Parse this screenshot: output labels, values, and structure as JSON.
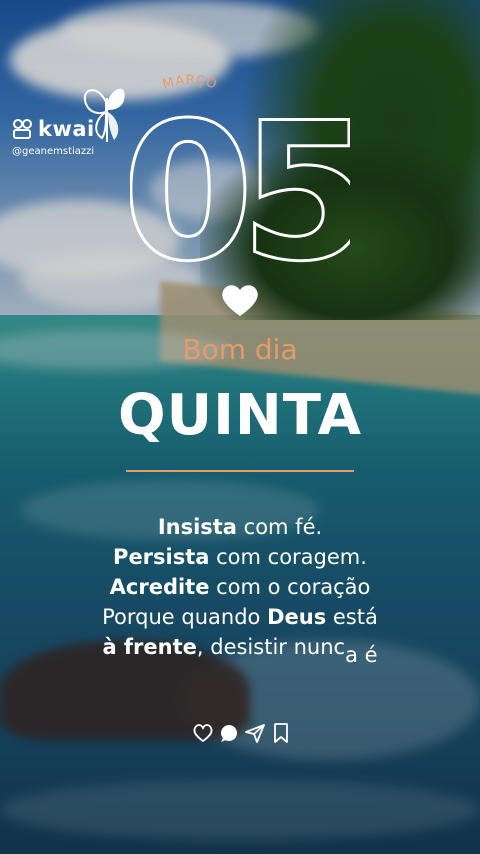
{
  "app": {
    "logo_text": "kwai",
    "handle": "@geanemstiazzi"
  },
  "date": {
    "month": "MARÇO",
    "day": "05"
  },
  "greeting": {
    "line1": "Bom dia",
    "line2": "QUINTA"
  },
  "quote": {
    "l1_bold": "Insista",
    "l1_rest": " com fé.",
    "l2_bold": "Persista",
    "l2_rest": " com coragem.",
    "l3_bold": "Acredite",
    "l3_rest": " com o coração",
    "l4_pre": "Porque quando ",
    "l4_bold": "Deus",
    "l4_post": " está",
    "l5_bold": "à frente",
    "l5_rest": ", desistir nunc",
    "l5_a": "a",
    "l5_e": " é"
  },
  "icons": [
    "heart-icon",
    "comment-icon",
    "send-icon",
    "bookmark-icon"
  ],
  "colors": {
    "accent": "#e79a6b",
    "text": "#ffffff"
  }
}
